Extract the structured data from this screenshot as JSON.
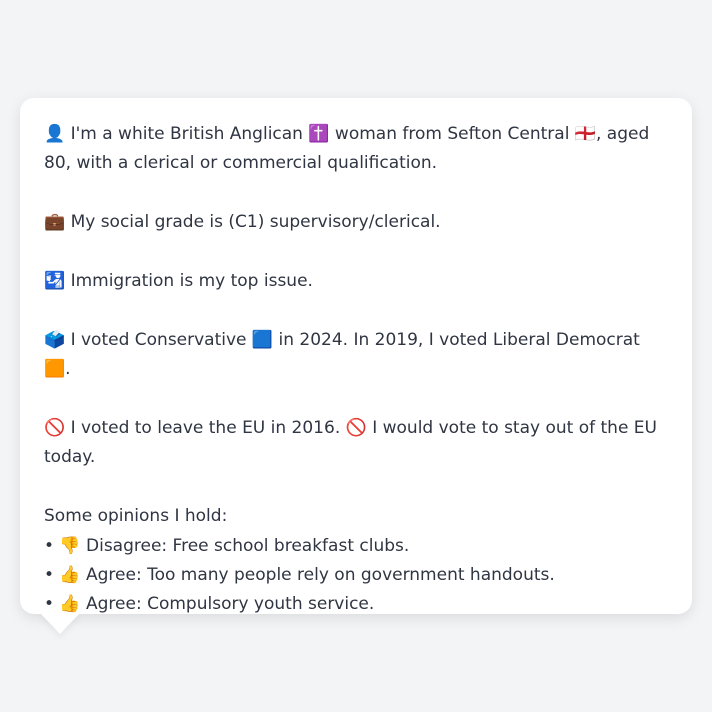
{
  "profile": {
    "identity": "👤 I'm a white British Anglican ✝️ woman from Sefton Central 🏴󠁧󠁢󠁥󠁮󠁧󠁿, aged 80, with a clerical or commercial qualification.",
    "social_grade": "💼 My social grade is (C1) supervisory/clerical.",
    "top_issue": "🛂 Immigration is my top issue.",
    "votes": "🗳️ I voted Conservative 🟦 in 2024. In 2019, I voted Liberal Democrat 🟧.",
    "eu": "🚫 I voted to leave the EU in 2016. 🚫 I would vote to stay out of the EU today."
  },
  "opinions": {
    "heading": "Some opinions I hold:",
    "items": [
      "• 👎 Disagree: Free school breakfast clubs.",
      "• 👍 Agree: Too many people rely on government handouts.",
      "• 👍 Agree: Compulsory youth service."
    ]
  }
}
